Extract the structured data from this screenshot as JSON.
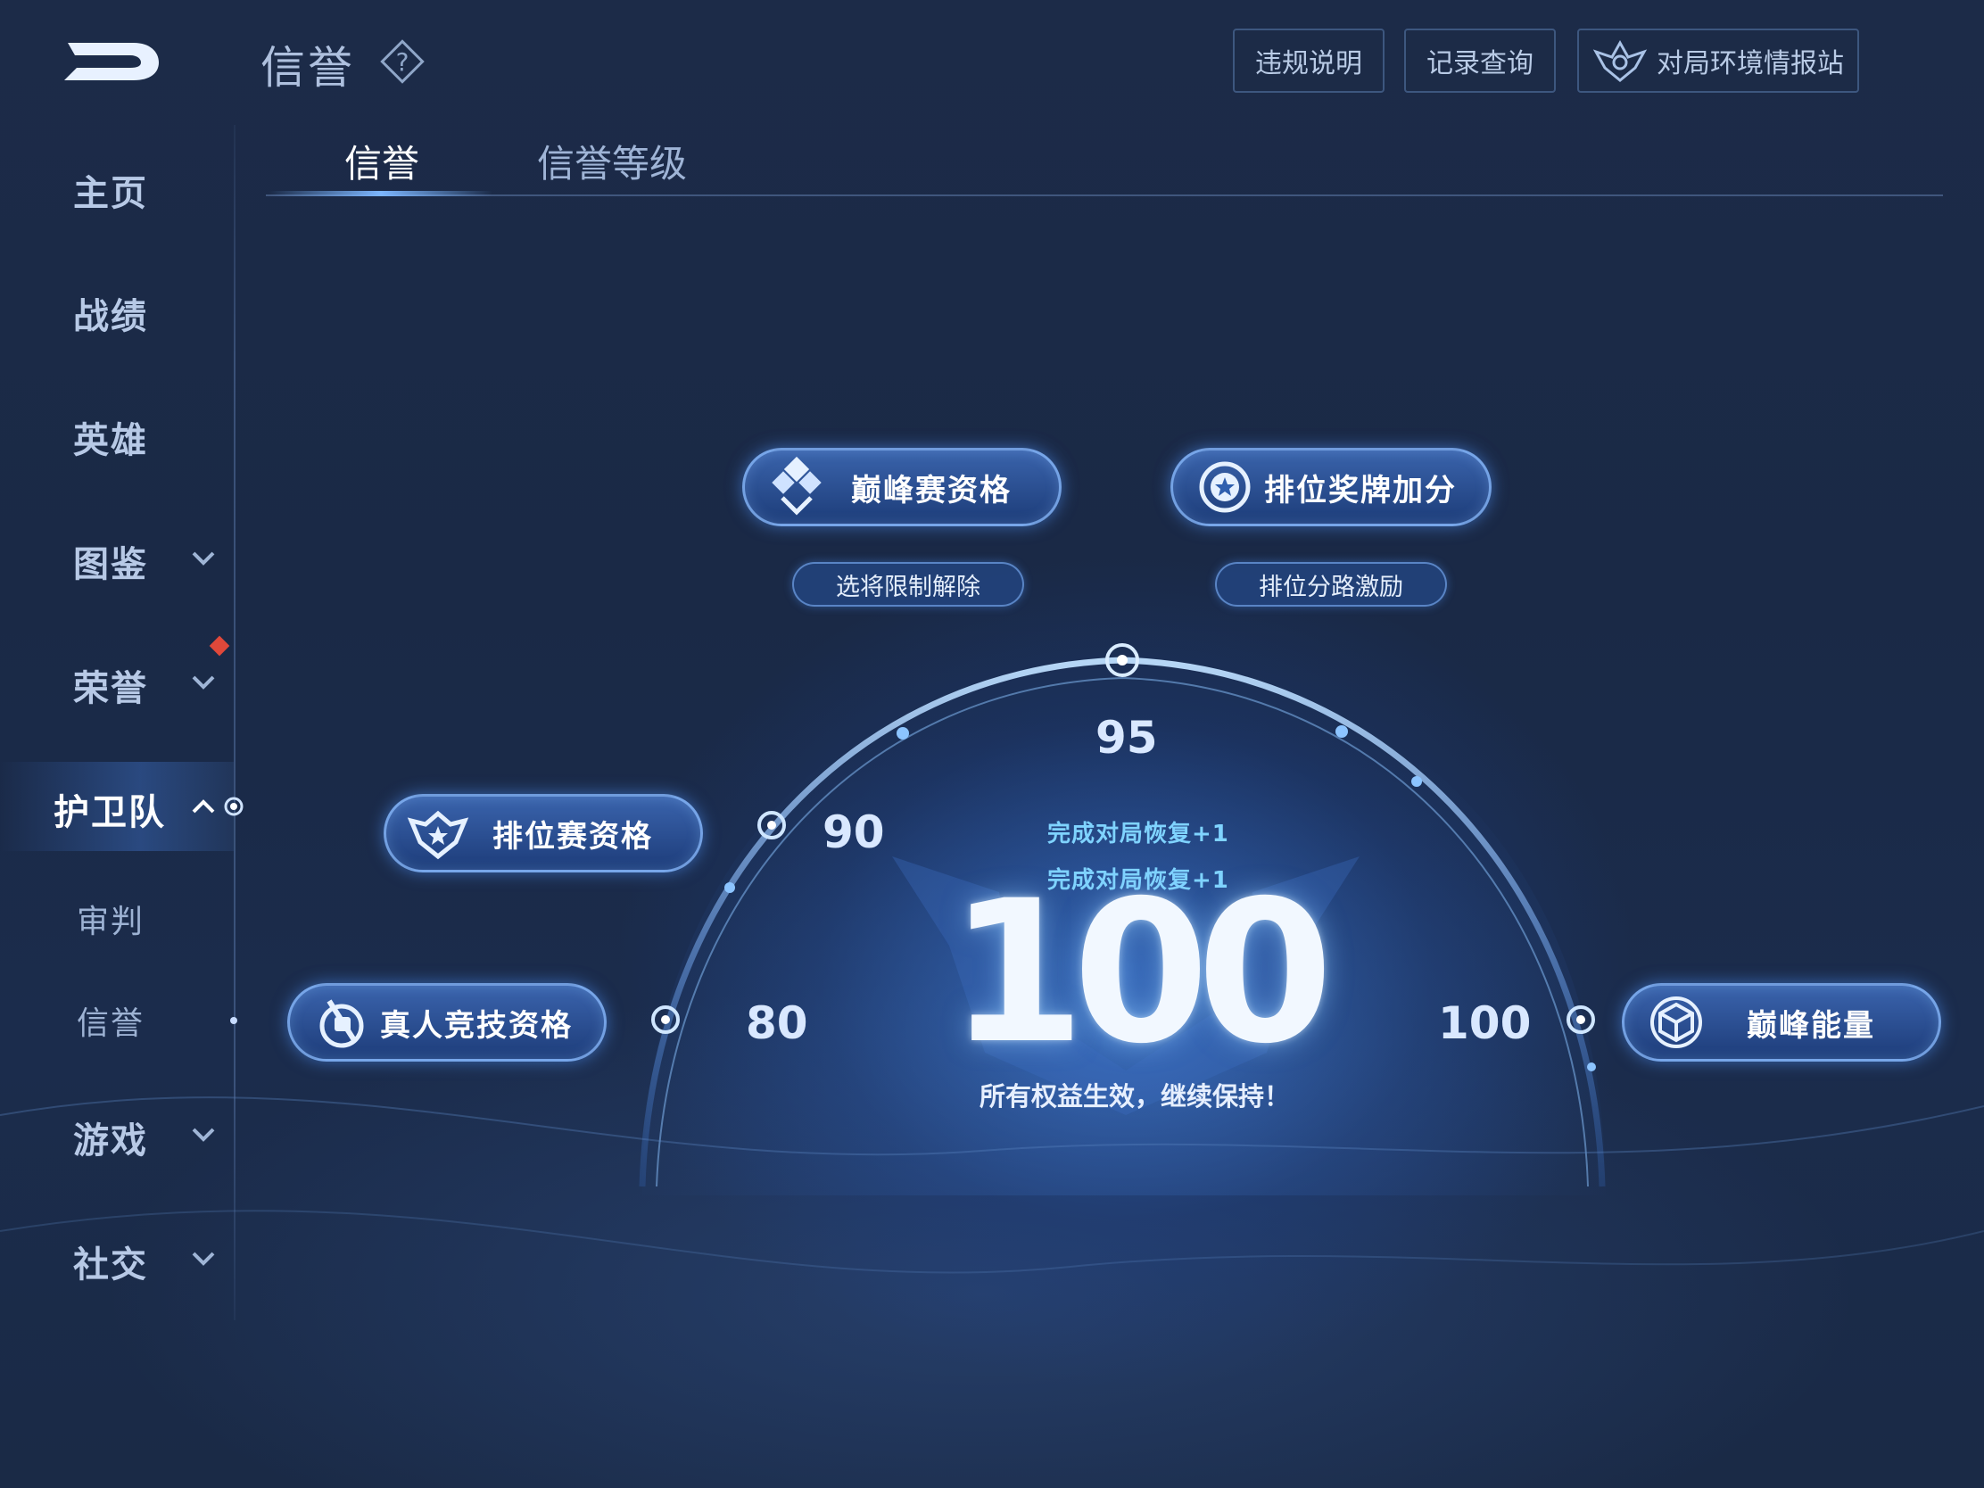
{
  "header": {
    "title": "信誉",
    "buttons": [
      {
        "label": "违规说明"
      },
      {
        "label": "记录查询"
      },
      {
        "label": "对局环境情报站"
      }
    ]
  },
  "sidebar": {
    "items": [
      {
        "label": "主页"
      },
      {
        "label": "战绩"
      },
      {
        "label": "英雄"
      },
      {
        "label": "图鉴"
      },
      {
        "label": "荣誉"
      },
      {
        "label": "护卫队"
      },
      {
        "label": "审判"
      },
      {
        "label": "信誉"
      },
      {
        "label": "游戏"
      },
      {
        "label": "社交"
      }
    ],
    "active": "护卫队",
    "badge_color": "#e0483a"
  },
  "tabs": [
    {
      "label": "信誉",
      "active": true
    },
    {
      "label": "信誉等级",
      "active": false
    }
  ],
  "gauge": {
    "score": "100",
    "thresholds": [
      "80",
      "90",
      "95",
      "100"
    ],
    "recovery_lines": [
      "完成对局恢复+1",
      "完成对局恢复+1"
    ],
    "status": "所有权益生效，继续保持！",
    "accent_color": "#5fa8ff"
  },
  "benefits": {
    "real_person": {
      "label": "真人竞技资格",
      "icon": "plug-icon"
    },
    "ranked": {
      "label": "排位赛资格",
      "icon": "shield-star-icon"
    },
    "peak": {
      "label": "巅峰赛资格",
      "icon": "crystal-icon",
      "sub": "选将限制解除"
    },
    "rank_medal": {
      "label": "排位奖牌加分",
      "icon": "medal-star-icon",
      "sub": "排位分路激励"
    },
    "peak_energy": {
      "label": "巅峰能量",
      "icon": "cube-icon"
    }
  }
}
